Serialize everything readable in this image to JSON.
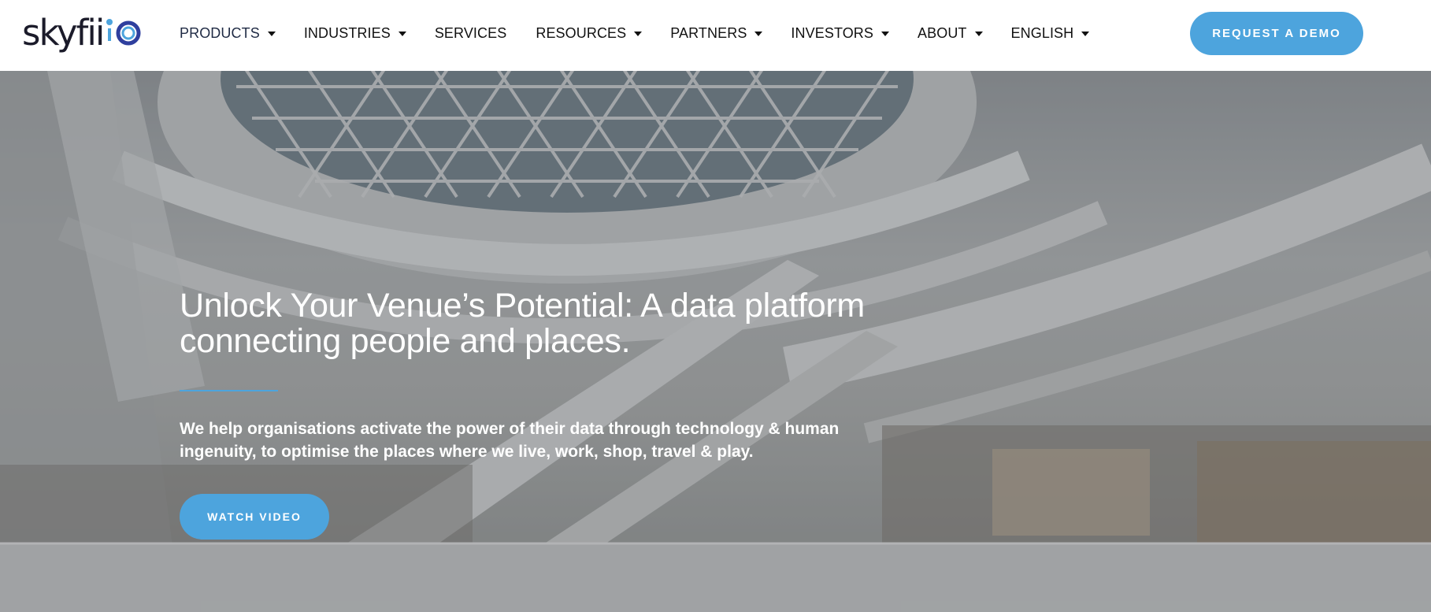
{
  "header": {
    "logo_text": "skyfii",
    "nav": [
      {
        "label": "PRODUCTS",
        "has_dropdown": true
      },
      {
        "label": "INDUSTRIES",
        "has_dropdown": true
      },
      {
        "label": "SERVICES",
        "has_dropdown": false
      },
      {
        "label": "RESOURCES",
        "has_dropdown": true
      },
      {
        "label": "PARTNERS",
        "has_dropdown": true
      },
      {
        "label": "INVESTORS",
        "has_dropdown": true
      },
      {
        "label": "ABOUT",
        "has_dropdown": true
      },
      {
        "label": "ENGLISH",
        "has_dropdown": true
      }
    ],
    "cta_label": "REQUEST A DEMO"
  },
  "hero": {
    "title_line1": "Unlock Your Venue’s Potential: A data platform",
    "title_line2": "connecting people and places.",
    "subtitle_line1": "We help organisations activate the power of their data through technology & human",
    "subtitle_line2": "ingenuity, to optimise the places where we live, work, shop, travel & play.",
    "video_button_label": "WATCH VIDEO",
    "background_icon": "shopping-mall-atrium-photo"
  },
  "colors": {
    "accent": "#4da4dd",
    "logo_dark": "#1b1b2a",
    "logo_blue": "#2f3f9e",
    "nav_text": "#111111"
  }
}
